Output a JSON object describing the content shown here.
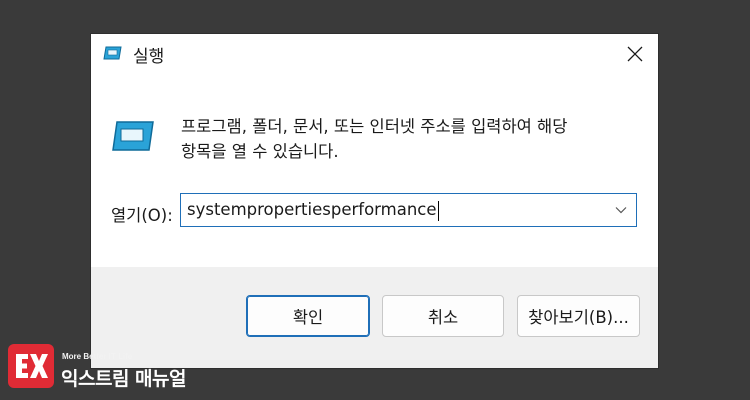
{
  "window": {
    "title": "실행",
    "icon": "run-icon"
  },
  "description": {
    "line1": "프로그램, 폴더, 문서, 또는 인터넷 주소를 입력하여 해당",
    "line2": "항목을 열 수 있습니다."
  },
  "open_field": {
    "label": "열기(O):",
    "value": "systempropertiesperformance"
  },
  "buttons": {
    "ok": "확인",
    "cancel": "취소",
    "browse": "찾아보기(B)..."
  },
  "watermark": {
    "tagline": "More Better IT Life",
    "name": "익스트림 매뉴얼"
  },
  "colors": {
    "accent": "#1f6fb8",
    "icon_blue": "#2aa3d8",
    "footer": "#f0f0f0",
    "background": "#3a3a3a",
    "logo_red": "#e02b35"
  }
}
